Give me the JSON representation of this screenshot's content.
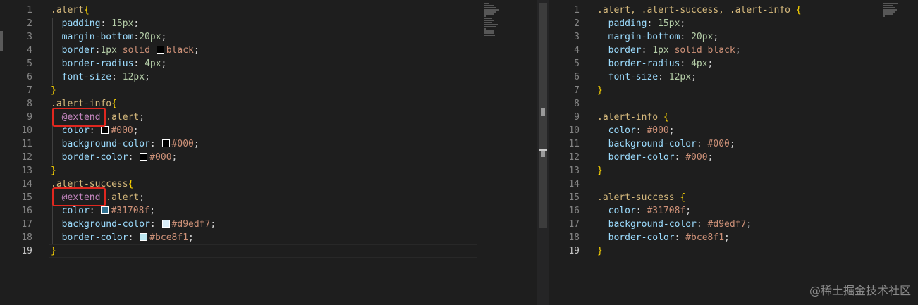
{
  "left_editor": {
    "current_line": 19,
    "lines": [
      {
        "n": "1",
        "tokens": [
          {
            "t": ".alert",
            "c": "sel"
          },
          {
            "t": "{",
            "c": "brace"
          }
        ]
      },
      {
        "n": "2",
        "tokens": [
          {
            "t": "  "
          },
          {
            "t": "padding",
            "c": "prop"
          },
          {
            "t": ": "
          },
          {
            "t": "15px",
            "c": "num"
          },
          {
            "t": ";"
          }
        ]
      },
      {
        "n": "3",
        "tokens": [
          {
            "t": "  "
          },
          {
            "t": "margin-bottom",
            "c": "prop"
          },
          {
            "t": ":"
          },
          {
            "t": "20px",
            "c": "num"
          },
          {
            "t": ";"
          }
        ]
      },
      {
        "n": "4",
        "tokens": [
          {
            "t": "  "
          },
          {
            "t": "border",
            "c": "prop"
          },
          {
            "t": ":"
          },
          {
            "t": "1px",
            "c": "num"
          },
          {
            "t": " solid ",
            "c": "val"
          },
          {
            "swatch": "#000000"
          },
          {
            "t": "black",
            "c": "val"
          },
          {
            "t": ";"
          }
        ]
      },
      {
        "n": "5",
        "tokens": [
          {
            "t": "  "
          },
          {
            "t": "border-radius",
            "c": "prop"
          },
          {
            "t": ": "
          },
          {
            "t": "4px",
            "c": "num"
          },
          {
            "t": ";"
          }
        ]
      },
      {
        "n": "6",
        "tokens": [
          {
            "t": "  "
          },
          {
            "t": "font-size",
            "c": "prop"
          },
          {
            "t": ": "
          },
          {
            "t": "12px",
            "c": "num"
          },
          {
            "t": ";"
          }
        ]
      },
      {
        "n": "7",
        "tokens": [
          {
            "t": "}",
            "c": "brace"
          }
        ]
      },
      {
        "n": "8",
        "tokens": [
          {
            "t": ".alert-info",
            "c": "sel"
          },
          {
            "t": "{",
            "c": "brace"
          }
        ]
      },
      {
        "n": "9",
        "tokens": [
          {
            "t": "  "
          },
          {
            "t": "@extend",
            "c": "kw"
          },
          {
            "t": " "
          },
          {
            "t": ".alert",
            "c": "sel"
          },
          {
            "t": ";"
          }
        ]
      },
      {
        "n": "10",
        "tokens": [
          {
            "t": "  "
          },
          {
            "t": "color",
            "c": "prop"
          },
          {
            "t": ": "
          },
          {
            "swatch": "#000000"
          },
          {
            "t": "#000",
            "c": "val"
          },
          {
            "t": ";"
          }
        ]
      },
      {
        "n": "11",
        "tokens": [
          {
            "t": "  "
          },
          {
            "t": "background-color",
            "c": "prop"
          },
          {
            "t": ": "
          },
          {
            "swatch": "#000000"
          },
          {
            "t": "#000",
            "c": "val"
          },
          {
            "t": ";"
          }
        ]
      },
      {
        "n": "12",
        "tokens": [
          {
            "t": "  "
          },
          {
            "t": "border-color",
            "c": "prop"
          },
          {
            "t": ": "
          },
          {
            "swatch": "#000000"
          },
          {
            "t": "#000",
            "c": "val"
          },
          {
            "t": ";"
          }
        ]
      },
      {
        "n": "13",
        "tokens": [
          {
            "t": "}",
            "c": "brace"
          }
        ]
      },
      {
        "n": "14",
        "tokens": [
          {
            "t": ".alert-success",
            "c": "sel"
          },
          {
            "t": "{",
            "c": "brace"
          }
        ]
      },
      {
        "n": "15",
        "tokens": [
          {
            "t": "  "
          },
          {
            "t": "@extend",
            "c": "kw"
          },
          {
            "t": " "
          },
          {
            "t": ".alert",
            "c": "sel"
          },
          {
            "t": ";"
          }
        ]
      },
      {
        "n": "16",
        "tokens": [
          {
            "t": "  "
          },
          {
            "t": "color",
            "c": "prop"
          },
          {
            "t": ": "
          },
          {
            "swatch": "#31708f"
          },
          {
            "t": "#31708f",
            "c": "val"
          },
          {
            "t": ";"
          }
        ]
      },
      {
        "n": "17",
        "tokens": [
          {
            "t": "  "
          },
          {
            "t": "background-color",
            "c": "prop"
          },
          {
            "t": ": "
          },
          {
            "swatch": "#d9edf7"
          },
          {
            "t": "#d9edf7",
            "c": "val"
          },
          {
            "t": ";"
          }
        ]
      },
      {
        "n": "18",
        "tokens": [
          {
            "t": "  "
          },
          {
            "t": "border-color",
            "c": "prop"
          },
          {
            "t": ": "
          },
          {
            "swatch": "#bce8f1"
          },
          {
            "t": "#bce8f1",
            "c": "val"
          },
          {
            "t": ";"
          }
        ]
      },
      {
        "n": "19",
        "tokens": [
          {
            "t": "}",
            "c": "brace"
          }
        ]
      }
    ]
  },
  "right_editor": {
    "current_line": 19,
    "lines": [
      {
        "n": "1",
        "tokens": [
          {
            "t": ".alert, .alert-success, .alert-info ",
            "c": "sel"
          },
          {
            "t": "{",
            "c": "brace"
          }
        ]
      },
      {
        "n": "2",
        "tokens": [
          {
            "t": "  "
          },
          {
            "t": "padding",
            "c": "prop"
          },
          {
            "t": ": "
          },
          {
            "t": "15px",
            "c": "num"
          },
          {
            "t": ";"
          }
        ]
      },
      {
        "n": "3",
        "tokens": [
          {
            "t": "  "
          },
          {
            "t": "margin-bottom",
            "c": "prop"
          },
          {
            "t": ": "
          },
          {
            "t": "20px",
            "c": "num"
          },
          {
            "t": ";"
          }
        ]
      },
      {
        "n": "4",
        "tokens": [
          {
            "t": "  "
          },
          {
            "t": "border",
            "c": "prop"
          },
          {
            "t": ": "
          },
          {
            "t": "1px",
            "c": "num"
          },
          {
            "t": " solid black",
            "c": "val"
          },
          {
            "t": ";"
          }
        ]
      },
      {
        "n": "5",
        "tokens": [
          {
            "t": "  "
          },
          {
            "t": "border-radius",
            "c": "prop"
          },
          {
            "t": ": "
          },
          {
            "t": "4px",
            "c": "num"
          },
          {
            "t": ";"
          }
        ]
      },
      {
        "n": "6",
        "tokens": [
          {
            "t": "  "
          },
          {
            "t": "font-size",
            "c": "prop"
          },
          {
            "t": ": "
          },
          {
            "t": "12px",
            "c": "num"
          },
          {
            "t": ";"
          }
        ]
      },
      {
        "n": "7",
        "tokens": [
          {
            "t": "}",
            "c": "brace"
          }
        ]
      },
      {
        "n": "8",
        "tokens": []
      },
      {
        "n": "9",
        "tokens": [
          {
            "t": ".alert-info ",
            "c": "sel"
          },
          {
            "t": "{",
            "c": "brace"
          }
        ]
      },
      {
        "n": "10",
        "tokens": [
          {
            "t": "  "
          },
          {
            "t": "color",
            "c": "prop"
          },
          {
            "t": ": "
          },
          {
            "t": "#000",
            "c": "val"
          },
          {
            "t": ";"
          }
        ]
      },
      {
        "n": "11",
        "tokens": [
          {
            "t": "  "
          },
          {
            "t": "background-color",
            "c": "prop"
          },
          {
            "t": ": "
          },
          {
            "t": "#000",
            "c": "val"
          },
          {
            "t": ";"
          }
        ]
      },
      {
        "n": "12",
        "tokens": [
          {
            "t": "  "
          },
          {
            "t": "border-color",
            "c": "prop"
          },
          {
            "t": ": "
          },
          {
            "t": "#000",
            "c": "val"
          },
          {
            "t": ";"
          }
        ]
      },
      {
        "n": "13",
        "tokens": [
          {
            "t": "}",
            "c": "brace"
          }
        ]
      },
      {
        "n": "14",
        "tokens": []
      },
      {
        "n": "15",
        "tokens": [
          {
            "t": ".alert-success ",
            "c": "sel"
          },
          {
            "t": "{",
            "c": "brace"
          }
        ]
      },
      {
        "n": "16",
        "tokens": [
          {
            "t": "  "
          },
          {
            "t": "color",
            "c": "prop"
          },
          {
            "t": ": "
          },
          {
            "t": "#31708f",
            "c": "val"
          },
          {
            "t": ";"
          }
        ]
      },
      {
        "n": "17",
        "tokens": [
          {
            "t": "  "
          },
          {
            "t": "background-color",
            "c": "prop"
          },
          {
            "t": ": "
          },
          {
            "t": "#d9edf7",
            "c": "val"
          },
          {
            "t": ";"
          }
        ]
      },
      {
        "n": "18",
        "tokens": [
          {
            "t": "  "
          },
          {
            "t": "border-color",
            "c": "prop"
          },
          {
            "t": ": "
          },
          {
            "t": "#bce8f1",
            "c": "val"
          },
          {
            "t": ";"
          }
        ]
      },
      {
        "n": "19",
        "tokens": [
          {
            "t": "}",
            "c": "brace"
          }
        ]
      }
    ]
  },
  "highlight_color": "#e0271f",
  "watermark": "@稀土掘金技术社区"
}
